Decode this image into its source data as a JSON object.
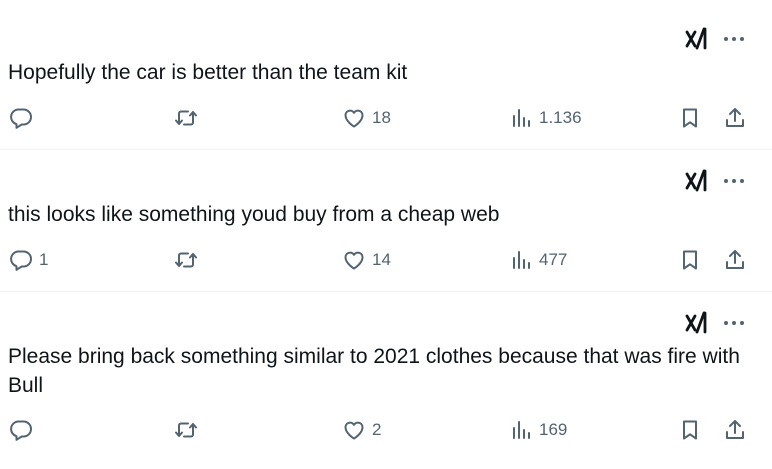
{
  "posts": [
    {
      "text": "Hopefully the car is better than the team kit",
      "replies": "",
      "reposts": "",
      "likes": "18",
      "views": "1.136"
    },
    {
      "text": "this looks like something youd buy from a cheap web",
      "replies": "1",
      "reposts": "",
      "likes": "14",
      "views": "477"
    },
    {
      "text": "Please bring back something similar to 2021 clothes because that was fire with Bull",
      "replies": "",
      "reposts": "",
      "likes": "2",
      "views": "169"
    }
  ],
  "icons": {
    "grok": "grok-icon",
    "more": "more-options-icon",
    "reply": "reply-icon",
    "repost": "repost-icon",
    "like": "like-heart-icon",
    "views": "views-chart-icon",
    "bookmark": "bookmark-icon",
    "share": "share-icon"
  },
  "colors": {
    "text": "#0f1419",
    "icon": "#536471",
    "divider": "#eff3f4"
  }
}
